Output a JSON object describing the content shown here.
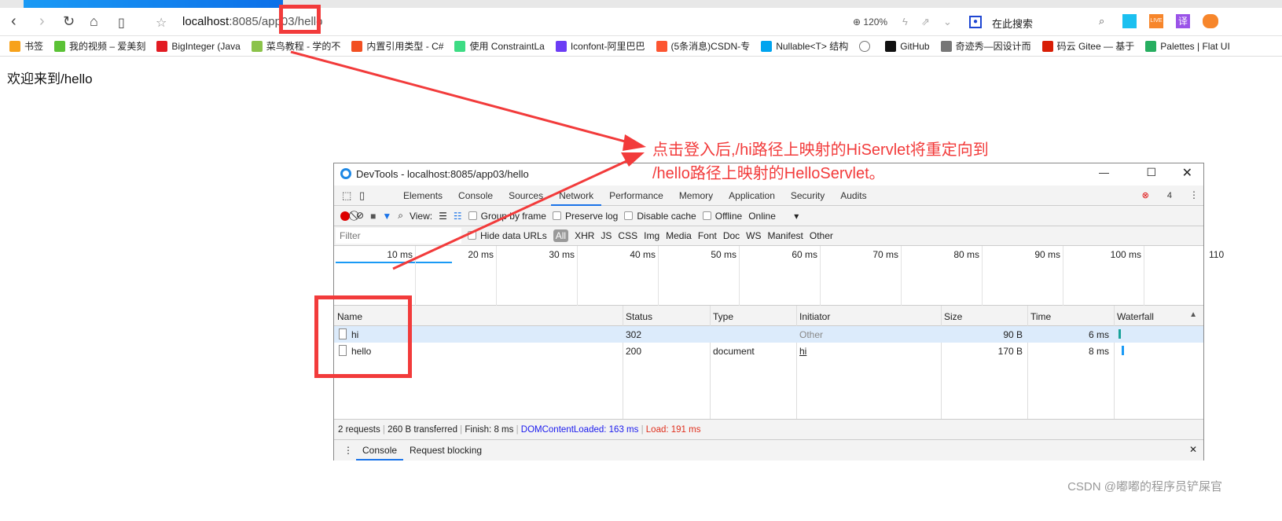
{
  "browser": {
    "url_host": "localhost",
    "url_rest": ":8085/app03/hello",
    "zoom": "120%",
    "search_placeholder": "在此搜索"
  },
  "bookmarks": [
    {
      "label": "书签",
      "color": "#f7a21b"
    },
    {
      "label": "我的视频 – 爱美刻",
      "color": "#5bc236"
    },
    {
      "label": "BigInteger (Java",
      "color": "#e21b23"
    },
    {
      "label": "菜鸟教程 - 学的不",
      "color": "#8bc34a"
    },
    {
      "label": "内置引用类型 - C#",
      "color": "#f25022"
    },
    {
      "label": "使用 ConstraintLa",
      "color": "#3ddc84"
    },
    {
      "label": "Iconfont-阿里巴巴",
      "color": "#6c3df5"
    },
    {
      "label": "(5条消息)CSDN-专",
      "color": "#fc5531"
    },
    {
      "label": "Nullable<T> 结构",
      "color": "#00a4ef"
    },
    {
      "label": "",
      "color": "#777"
    },
    {
      "label": "GitHub",
      "color": "#111"
    },
    {
      "label": "奇迹秀—因设计而",
      "color": "#777"
    },
    {
      "label": "码云 Gitee — 基于",
      "color": "#d81e06"
    },
    {
      "label": "Palettes | Flat UI",
      "color": "#27ae60"
    }
  ],
  "page": {
    "welcome": "欢迎来到/hello"
  },
  "devtools": {
    "title": "DevTools - localhost:8085/app03/hello",
    "tabs": [
      "Elements",
      "Console",
      "Sources",
      "Network",
      "Performance",
      "Memory",
      "Application",
      "Security",
      "Audits"
    ],
    "active_tab": "Network",
    "error_count": "4",
    "toolbar": {
      "view": "View:",
      "group_by_frame": "Group by frame",
      "preserve_log": "Preserve log",
      "disable_cache": "Disable cache",
      "offline": "Offline",
      "throttle": "Online"
    },
    "filter": {
      "placeholder": "Filter",
      "hide_data_urls": "Hide data URLs",
      "types": [
        "All",
        "XHR",
        "JS",
        "CSS",
        "Img",
        "Media",
        "Font",
        "Doc",
        "WS",
        "Manifest",
        "Other"
      ]
    },
    "timeline_ticks": [
      "10 ms",
      "20 ms",
      "30 ms",
      "40 ms",
      "50 ms",
      "60 ms",
      "70 ms",
      "80 ms",
      "90 ms",
      "100 ms",
      "110"
    ],
    "columns": [
      "Name",
      "Status",
      "Type",
      "Initiator",
      "Size",
      "Time",
      "Waterfall"
    ],
    "rows": [
      {
        "name": "hi",
        "status": "302",
        "type": "",
        "initiator": "Other",
        "size": "90 B",
        "time": "6 ms"
      },
      {
        "name": "hello",
        "status": "200",
        "type": "document",
        "initiator": "hi",
        "size": "170 B",
        "time": "8 ms"
      }
    ],
    "status": {
      "requests": "2 requests",
      "transferred": "260 B transferred",
      "finish": "Finish: 8 ms",
      "dcl": "DOMContentLoaded: 163 ms",
      "load": "Load: 191 ms"
    },
    "drawer": {
      "tabs": [
        "Console",
        "Request blocking"
      ]
    }
  },
  "annotation": {
    "line1": "点击登入后,/hi路径上映射的HiServlet将重定向到",
    "line2": "/hello路径上映射的HelloServlet。",
    "color": "#f23b3b"
  },
  "watermark": "CSDN @嘟嘟的程序员铲屎官"
}
